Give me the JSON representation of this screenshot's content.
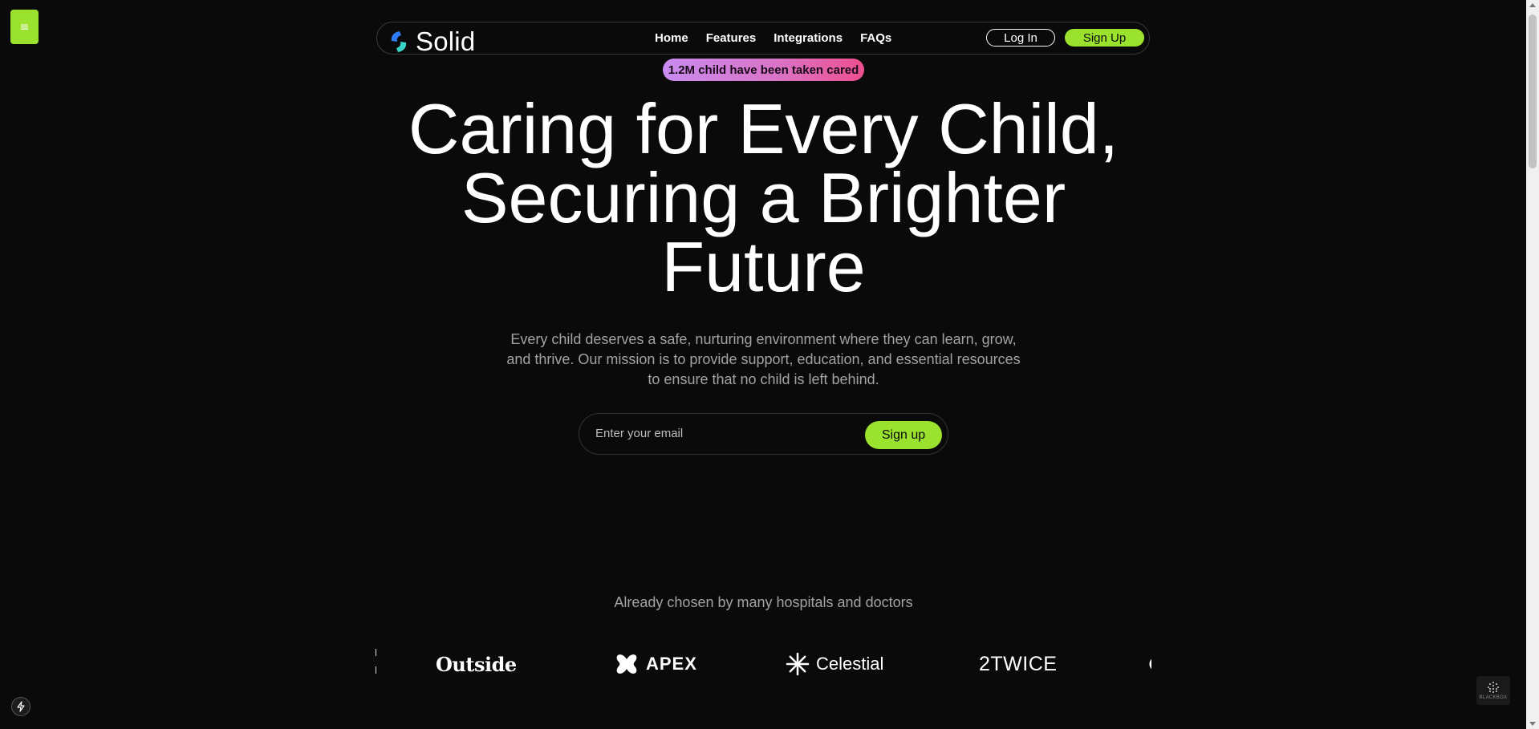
{
  "nav": {
    "brand": "Solid",
    "links": [
      "Home",
      "Features",
      "Integrations",
      "FAQs"
    ],
    "login": "Log In",
    "signup": "Sign Up"
  },
  "menu_button": {
    "icon": "hamburger-icon",
    "glyph": "≡"
  },
  "badge": "1.2M child have been taken cared",
  "hero": {
    "title": "Caring for Every Child, Securing a Brighter Future",
    "subtitle": "Every child deserves a safe, nurturing environment where they can learn, grow, and thrive. Our mission is to provide support, education, and essential resources to ensure that no child is left behind."
  },
  "email_form": {
    "placeholder": "Enter your email",
    "submit": "Sign up"
  },
  "trusted": {
    "heading": "Already chosen by many hospitals and doctors",
    "logos": [
      "Outside",
      "APEX",
      "Celestial",
      "2TWICE"
    ]
  },
  "widget": {
    "label": "BLACKBOX"
  },
  "colors": {
    "background": "#0a0a0a",
    "accent": "#9be22e",
    "badge_gradient_start": "#c98bf0",
    "badge_gradient_end": "#ee4f8f",
    "muted_text": "#a3a3a3"
  }
}
